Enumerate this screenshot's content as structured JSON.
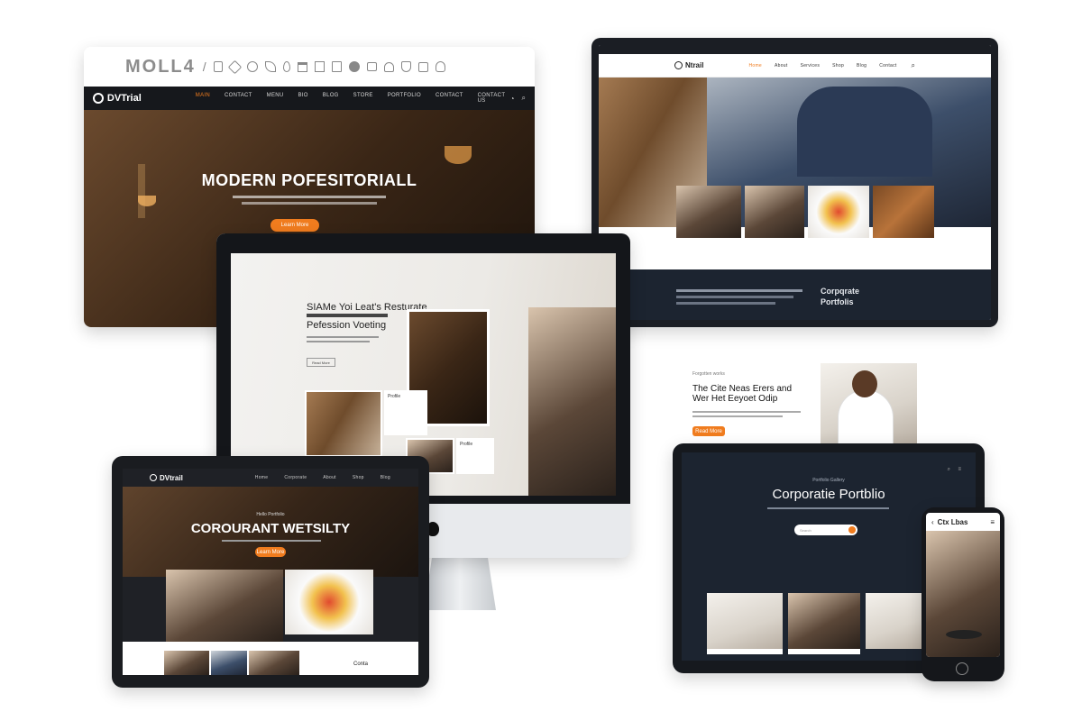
{
  "icon_strip": {
    "text": "MOLL4",
    "icons": [
      "slash-icon",
      "clipboard-icon",
      "tag-icon",
      "palette-icon",
      "leaf-icon",
      "pin-icon",
      "calendar-icon",
      "list-icon",
      "chart-icon",
      "compass-icon",
      "lock-icon",
      "user-icon",
      "shield-icon",
      "bag-icon",
      "person-icon"
    ]
  },
  "top_left_site": {
    "logo": "DVTrial",
    "nav": [
      "MAIN",
      "CONTACT",
      "MENU",
      "BIO",
      "BLOG",
      "STORE",
      "PORTFOLIO",
      "CONTACT",
      "CONTACT US"
    ],
    "headline": "MODERN POFESITORIALL",
    "cta": "Learn More"
  },
  "top_right_site": {
    "logo": "Ntrail",
    "nav": [
      "Home",
      "About",
      "Services",
      "Shop",
      "Blog",
      "Contact"
    ],
    "footer_heading": "Corpqrate Portfolis"
  },
  "imac_site": {
    "headline_line1": "SIAMe Yoi Leat's Resturate",
    "headline_line2": "Pefession Voeting",
    "button": "Read More",
    "card1_title": "Profile",
    "card2_title": "Profile"
  },
  "floating_text": {
    "kicker": "Forgotten works",
    "headline_line1": "The Cite Neas Erers and",
    "headline_line2": "Wer Het Eeyoet Odip",
    "button": "Read More"
  },
  "tablet_left_site": {
    "logo": "DVtrail",
    "nav": [
      "Home",
      "Corporate",
      "About",
      "Shop",
      "Blog"
    ],
    "kicker": "Hello Portfolio",
    "headline": "COROURANT WETSILTY",
    "button": "Learn More",
    "footer_tag": "Conta"
  },
  "tablet_right_site": {
    "kicker": "Portfolio Gallery",
    "headline": "Corporatie Portblio",
    "search_placeholder": "Search"
  },
  "phone_site": {
    "title": "Ctx Lbas"
  },
  "colors": {
    "accent": "#f07c1e",
    "dark": "#1b1e24",
    "navy": "#1c2430"
  }
}
